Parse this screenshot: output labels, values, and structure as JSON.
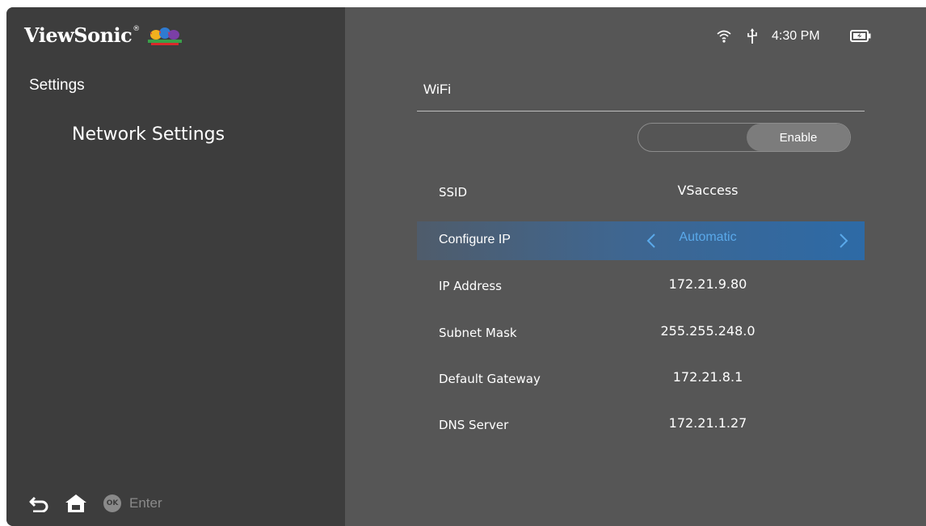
{
  "brand": {
    "name": "ViewSonic",
    "reg": "®"
  },
  "sidebar": {
    "breadcrumb": "Settings",
    "subtitle": "Network Settings",
    "hint": {
      "ok_badge": "OK",
      "enter": "Enter"
    }
  },
  "status_bar": {
    "time": "4:30 PM"
  },
  "main": {
    "section_title": "WiFi",
    "toggle": {
      "state_label": "Enable",
      "enabled": true
    },
    "rows": [
      {
        "label": "SSID",
        "value": "VSaccess"
      },
      {
        "label": "Configure IP",
        "value": "Automatic"
      },
      {
        "label": "IP Address",
        "value": "172.21.9.80"
      },
      {
        "label": "Subnet Mask",
        "value": "255.255.248.0"
      },
      {
        "label": "Default Gateway",
        "value": "172.21.8.1"
      },
      {
        "label": "DNS Server",
        "value": "172.21.1.27"
      }
    ]
  },
  "colors": {
    "accent": "#2d6aa6",
    "value_accent": "#5aa9ea",
    "sidebar_bg": "#3d3d3d",
    "panel_bg": "#565656"
  },
  "icons": [
    "back-icon",
    "home-icon",
    "ok-icon",
    "wifi-icon",
    "usb-icon",
    "battery-icon",
    "chevron-left-icon",
    "chevron-right-icon"
  ]
}
